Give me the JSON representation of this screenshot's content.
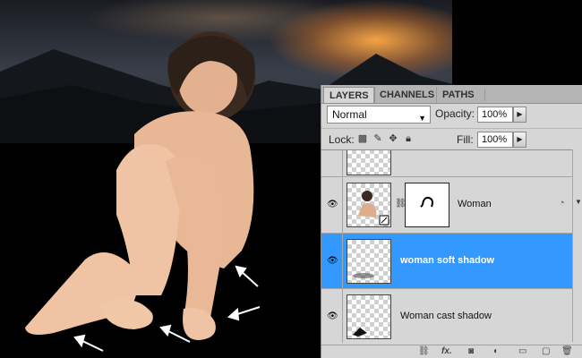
{
  "tabs": [
    "LAYERS",
    "CHANNELS",
    "PATHS"
  ],
  "blend_mode": "Normal",
  "opacity": {
    "label": "Opacity:",
    "value": "100%"
  },
  "fill": {
    "label": "Fill:",
    "value": "100%"
  },
  "lock_label": "Lock:",
  "layers": [
    {
      "name": "",
      "visible": false,
      "selected": false
    },
    {
      "name": "Woman",
      "visible": true,
      "selected": false
    },
    {
      "name": "woman soft shadow",
      "visible": true,
      "selected": true
    },
    {
      "name": "Woman cast shadow",
      "visible": true,
      "selected": false
    }
  ],
  "icons": {
    "eye": "eye-icon",
    "link": "chain-link-icon",
    "fx": "fx-icon",
    "mask": "add-mask-icon",
    "adjust": "adjustment-layer-icon",
    "group": "folder-icon",
    "new": "new-layer-icon",
    "trash": "trash-icon"
  },
  "bottom_fx_label": "fx.",
  "colors": {
    "selection": "#3399ff",
    "panel": "#d6d6d6"
  }
}
